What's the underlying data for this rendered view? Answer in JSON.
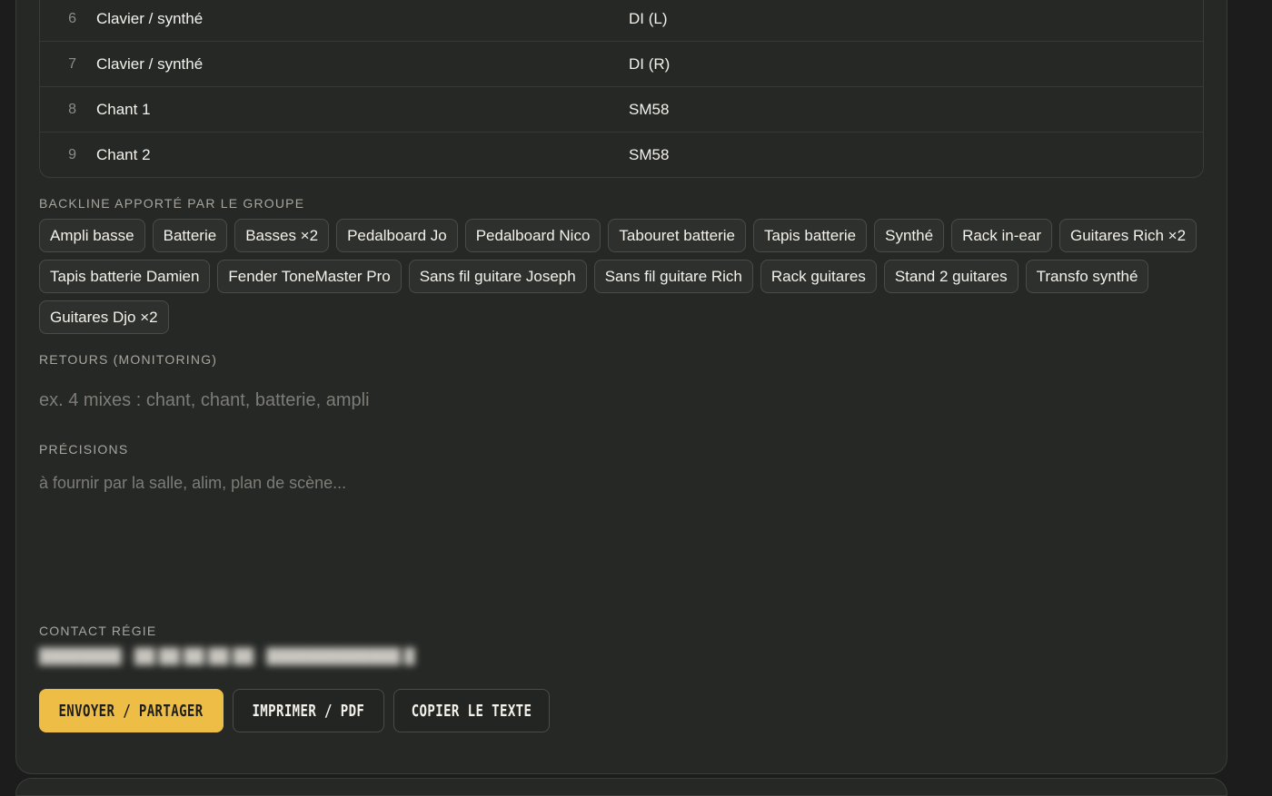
{
  "channels": [
    {
      "num": "6",
      "name": "Clavier / synthé",
      "mic": "DI (L)"
    },
    {
      "num": "7",
      "name": "Clavier / synthé",
      "mic": "DI (R)"
    },
    {
      "num": "8",
      "name": "Chant 1",
      "mic": "SM58"
    },
    {
      "num": "9",
      "name": "Chant 2",
      "mic": "SM58"
    }
  ],
  "backline": {
    "label": "BACKLINE APPORTÉ PAR LE GROUPE",
    "items": [
      "Ampli basse",
      "Batterie",
      "Basses ×2",
      "Pedalboard Jo",
      "Pedalboard Nico",
      "Tabouret batterie",
      "Tapis batterie",
      "Synthé",
      "Rack in-ear",
      "Guitares Rich ×2",
      "Tapis batterie Damien",
      "Fender ToneMaster Pro",
      "Sans fil guitare Joseph",
      "Sans fil guitare Rich",
      "Rack guitares",
      "Stand 2 guitares",
      "Transfo synthé",
      "Guitares Djo ×2"
    ]
  },
  "retours": {
    "label": "RETOURS (MONITORING)",
    "placeholder": "ex. 4 mixes : chant, chant, batterie, ampli"
  },
  "precisions": {
    "label": "PRÉCISIONS",
    "placeholder": "à fournir par la salle, alim, plan de scène..."
  },
  "contact": {
    "label": "CONTACT RÉGIE"
  },
  "actions": {
    "send_label": "ENVOYER / PARTAGER",
    "print_label": "IMPRIMER / PDF",
    "copy_label": "COPIER LE TEXTE"
  },
  "colors": {
    "accent": "#eebd45",
    "panel": "#262826",
    "background": "#1b1c1b"
  }
}
